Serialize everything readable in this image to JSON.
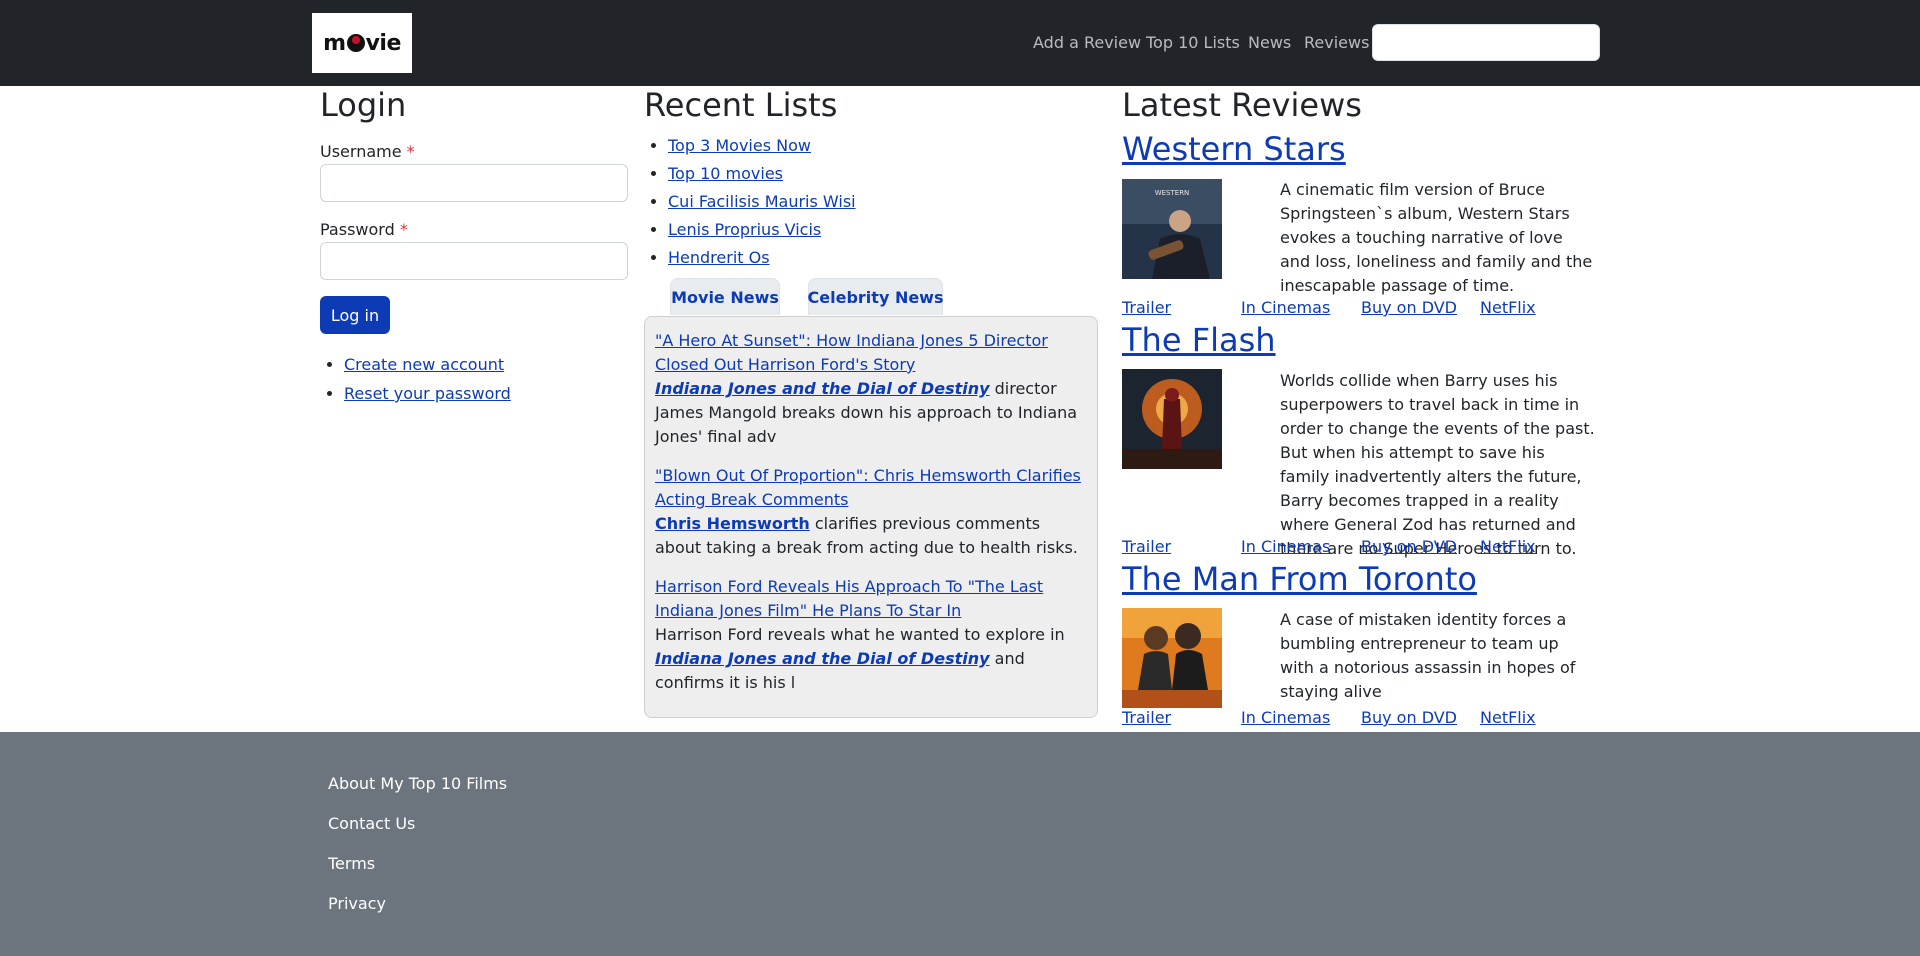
{
  "header": {
    "logo_text_pre": "m",
    "logo_text_post": "vie",
    "nav": [
      "Add a Review",
      "Top 10 Lists",
      "News",
      "Reviews"
    ],
    "search_placeholder": ""
  },
  "login": {
    "title": "Login",
    "username_label": "Username",
    "password_label": "Password",
    "required_mark": "*",
    "button": "Log in",
    "links": [
      "Create new account",
      "Reset your password"
    ]
  },
  "recent_lists": {
    "title": "Recent Lists",
    "items": [
      "Top 3 Movies Now",
      "Top 10 movies",
      "Cui Facilisis Mauris Wisi",
      "Lenis Proprius Vicis",
      "Hendrerit Os"
    ],
    "tabs": [
      "Movie News",
      "Celebrity News"
    ],
    "news": [
      {
        "headline": "\"A Hero At Sunset\": How Indiana Jones 5 Director Closed Out Harrison Ford's Story",
        "link": "Indiana Jones and the Dial of Destiny",
        "text": " director James Mangold breaks down his approach to Indiana Jones' final adv"
      },
      {
        "headline": "\"Blown Out Of Proportion\": Chris Hemsworth Clarifies Acting Break Comments",
        "link": "Chris Hemsworth",
        "text": " clarifies previous comments about taking a break from acting due to health risks."
      },
      {
        "headline": "Harrison Ford Reveals His Approach To \"The Last Indiana Jones Film\" He Plans To Star In",
        "pre": "Harrison Ford reveals what he wanted to explore in ",
        "link": "Indiana Jones and the Dial of Destiny",
        "text": " and confirms it is his l"
      }
    ]
  },
  "reviews": {
    "title": "Latest Reviews",
    "link_labels": [
      "Trailer",
      "In Cinemas",
      "Buy on DVD",
      "NetFlix"
    ],
    "items": [
      {
        "title": "Western Stars",
        "desc": "A cinematic film version of Bruce Springsteen`s album, Western Stars evokes a touching narrative of love and loss, loneliness and family and the inescapable passage of time."
      },
      {
        "title": "The Flash",
        "desc": "Worlds collide when Barry uses his superpowers to travel back in time in order to change the events of the past. But when his attempt to save his family inadvertently alters the future, Barry becomes trapped in a reality where General Zod has returned and there are no Super Heroes to turn to."
      },
      {
        "title": "The Man From Toronto",
        "desc": "A case of mistaken identity forces a bumbling entrepreneur to team up with a notorious assassin in hopes of staying alive"
      }
    ]
  },
  "footer": {
    "links": [
      "About My Top 10 Films",
      "Contact Us",
      "Terms",
      "Privacy"
    ]
  },
  "colors": {
    "header_bg": "#212529",
    "link": "#0d3bb5",
    "footer_bg": "#6c757d",
    "panel_bg": "#eeeeee"
  }
}
